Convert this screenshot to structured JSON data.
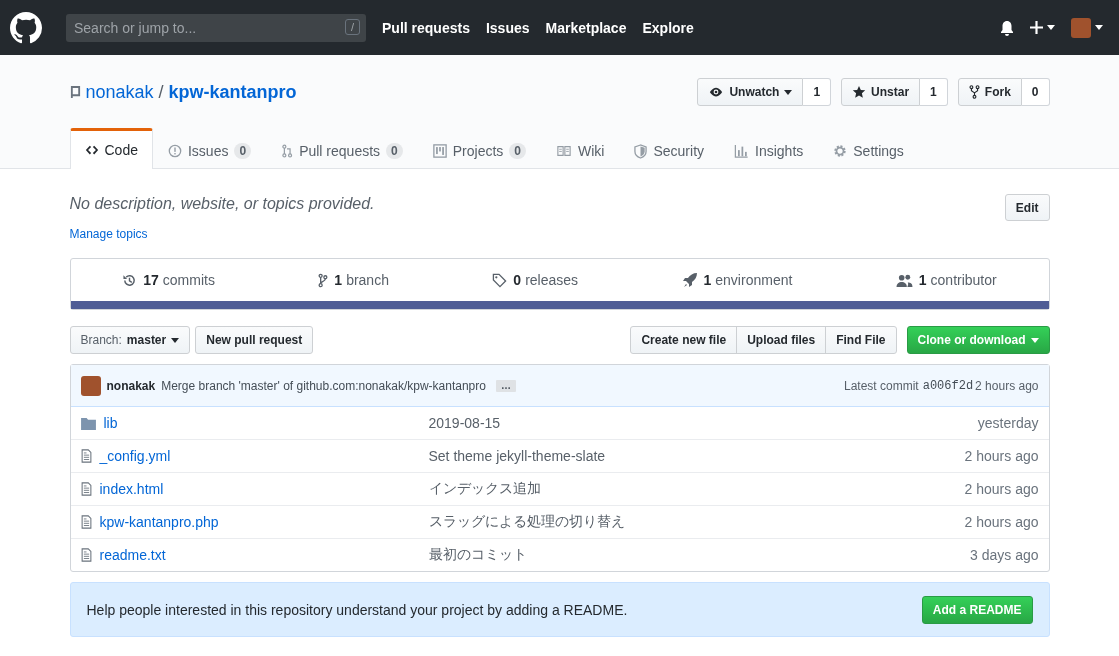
{
  "header": {
    "search": {
      "placeholder": "Search or jump to..."
    },
    "slash_key": "/",
    "nav": [
      "Pull requests",
      "Issues",
      "Marketplace",
      "Explore"
    ]
  },
  "repo": {
    "owner": "nonakak",
    "separator": "/",
    "name": "kpw-kantanpro",
    "actions": [
      {
        "kind": "watch",
        "label": "Unwatch",
        "count": "1"
      },
      {
        "kind": "star",
        "label": "Unstar",
        "count": "1"
      },
      {
        "kind": "fork",
        "label": "Fork",
        "count": "0"
      }
    ]
  },
  "tabs": [
    {
      "kind": "code",
      "label": "Code",
      "selected": true
    },
    {
      "kind": "issues",
      "label": "Issues",
      "count": "0",
      "selected": false
    },
    {
      "kind": "pulls",
      "label": "Pull requests",
      "count": "0",
      "selected": false
    },
    {
      "kind": "projects",
      "label": "Projects",
      "count": "0",
      "selected": false
    },
    {
      "kind": "wiki",
      "label": "Wiki",
      "selected": false
    },
    {
      "kind": "security",
      "label": "Security",
      "selected": false
    },
    {
      "kind": "insights",
      "label": "Insights",
      "selected": false
    },
    {
      "kind": "settings",
      "label": "Settings",
      "selected": false
    }
  ],
  "description": "No description, website, or topics provided.",
  "edit_button": "Edit",
  "manage_topics": "Manage topics",
  "summary": [
    {
      "kind": "commits",
      "count": "17",
      "label": "commits"
    },
    {
      "kind": "branch",
      "count": "1",
      "label": "branch"
    },
    {
      "kind": "releases",
      "count": "0",
      "label": "releases"
    },
    {
      "kind": "environment",
      "count": "1",
      "label": "environment"
    },
    {
      "kind": "contributor",
      "count": "1",
      "label": "contributor"
    }
  ],
  "language_bar": [
    {
      "color": "#4f5d95",
      "level": 1
    }
  ],
  "toolbar": {
    "branch_label": "Branch:",
    "branch": "master",
    "new_pull_request": "New pull request",
    "file_buttons": [
      "Create new file",
      "Upload files",
      "Find File"
    ],
    "clone": "Clone or download"
  },
  "commit": {
    "author": "nonakak",
    "message": "Merge branch 'master' of github.com:nonakak/kpw-kantanpro",
    "ellipsis": "…",
    "latest_label": "Latest commit",
    "sha": "a006f2d",
    "time": "2 hours ago"
  },
  "files": [
    {
      "kind": "folder",
      "name": "lib",
      "message": "2019-08-15",
      "age": "yesterday"
    },
    {
      "kind": "file",
      "name": "_config.yml",
      "message": "Set theme jekyll-theme-slate",
      "age": "2 hours ago"
    },
    {
      "kind": "file",
      "name": "index.html",
      "message": "インデックス追加",
      "age": "2 hours ago"
    },
    {
      "kind": "file",
      "name": "kpw-kantanpro.php",
      "message": "スラッグによる処理の切り替え",
      "age": "2 hours ago"
    },
    {
      "kind": "file",
      "name": "readme.txt",
      "message": "最初のコミット",
      "age": "3 days ago"
    }
  ],
  "readme_banner": {
    "text": "Help people interested in this repository understand your project by adding a README.",
    "button": "Add a README"
  }
}
